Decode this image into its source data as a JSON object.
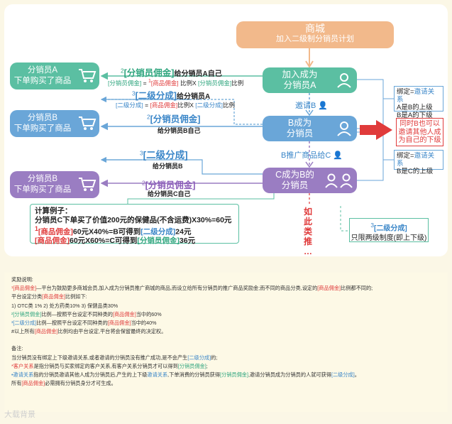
{
  "mall": {
    "title": "商城",
    "subtitle": "加入二级制分销员计划"
  },
  "buyers": {
    "a": {
      "line1": "分销员A",
      "line2": "下单购买了商品"
    },
    "b": {
      "line1": "分销员B",
      "line2": "下单购买了商品"
    },
    "c": {
      "line1": "分销员B",
      "line2": "下单购买了商品"
    }
  },
  "nodes": {
    "a": {
      "line1": "加入成为",
      "line2": "分销员A"
    },
    "b": {
      "line1": "B成为",
      "line2": "分销员"
    },
    "c": {
      "line1": "C成为B的",
      "line2": "分销员"
    }
  },
  "flows": {
    "a_main_sup": "2",
    "a_main_tag": "[分销员佣金]",
    "a_main_text": "给分销员A自己",
    "a_sub_1": "[分销员佣金]",
    "a_sub_2": "=",
    "a_sub_3": "1",
    "a_sub_4": "[商品佣金]",
    "a_sub_5": "比例X",
    "a_sub_6": "[分销员佣金]",
    "a_sub_7": "比例",
    "b1_sup": "3",
    "b1_tag": "[二级分成]",
    "b1_text": "给分销员A",
    "b1_sub_1": "[二级分成]",
    "b1_sub_2": "=",
    "b1_sub_3": "[商品佣金]",
    "b1_sub_4": "比例X",
    "b1_sub_5": "[二级分成]",
    "b1_sub_6": "比例",
    "b2_sup": "2",
    "b2_tag": "[分销员佣金]",
    "b2_sub": "给分销员B自己",
    "c1_sup": "3",
    "c1_tag": "[二级分成]",
    "c1_sub": "给分销员B",
    "c2_sup": "2",
    "c2_tag": "[分销员佣金]",
    "c2_sub": "给分销员C自己"
  },
  "invite_b": "邀请B",
  "promote_c": "B推广商品给C",
  "side_a": {
    "l1a": "绑定=",
    "l1b": "邀请关系",
    "l2": "A是B的上级",
    "l3": "B是A的下级"
  },
  "side_b": {
    "l1a": "绑定=",
    "l1b": "邀请关系",
    "l2": "B是C的上级"
  },
  "red_box": "同时B也可以邀请其他人成为自己的下级",
  "more_vertical": [
    "如",
    "此",
    "类",
    "推",
    "…"
  ],
  "calc": {
    "title": "计算例子：",
    "l1": "分销员C下单买了价值200元的保健品(不含运费)X30%=60元",
    "l2_sup": "1",
    "l2_tag": "[商品佣金]",
    "l2_text": "60元X40%=B可得到",
    "l2_tag2": "[二级分成]",
    "l2_end": "24元",
    "l3_tag": "[商品佣金]",
    "l3_text": "60元X60%=C可得到",
    "l3_tag2": "[分销员佣金]",
    "l3_end": "36元"
  },
  "two_level": {
    "sup": "3",
    "tag": "[二级分成]",
    "text": "只限两级制度(即上下级)"
  },
  "notes": {
    "title": "奖励说明:",
    "n1a": "¹[商品佣金]",
    "n1b": "—平台为鼓励更多商城会员,加入成为分销员推广商城的商品,而设立给所有分销员的推广商品奖励金;而不同的商品分类,设定的",
    "n1c": "[商品佣金]",
    "n1d": "比例都不同的;",
    "n2a": "平台设定分类",
    "n2b": "[商品佣金]",
    "n2c": "比例如下:",
    "n3": "1) OTC类 1%     2) 处方药类10%     3) 保健品类30%",
    "n4a": "²[分销员佣金]",
    "n4b": "比例—按照平台设定不同种类的",
    "n4c": "[商品佣金]",
    "n4d": "当中的60%",
    "n5a": "³[二级分成]",
    "n5b": "比例—按照平台设定不同种类的",
    "n5c": "[商品佣金]",
    "n5d": "当中的40%",
    "n6a": "#以上所有",
    "n6b": "[商品佣金]",
    "n6c": "比例均由平台设定,平台将会保留最终的决定权。",
    "remark": "备注:",
    "r1a": "当分销员没有绑定上下级邀请关系,或者邀请的分销员没有推广成功,是不会产生",
    "r1b": "[二级分成]",
    "r1c": "的;",
    "r2a": "*客户关系",
    "r2b": "是指分销员与买家绑定的客户关系,有客户关系分销员才可以得到",
    "r2c": "[分销员佣金]",
    "r2d": ";",
    "r3a": "•邀请关系",
    "r3b": "指的分销员邀请其他人成为分销员后,产生的上下级",
    "r3c": "邀请关系",
    "r3d": ",下单消费的分销员获得",
    "r3e": "[分销员佣金]",
    "r3f": ",邀请分销员成为分销员的人就可获得",
    "r3g": "[二级分成]",
    "r3h": "。",
    "r4a": "所有",
    "r4b": "[商品佣金]",
    "r4c": "必需拥有分销员身分才可生成。"
  },
  "watermark": "大载背景"
}
